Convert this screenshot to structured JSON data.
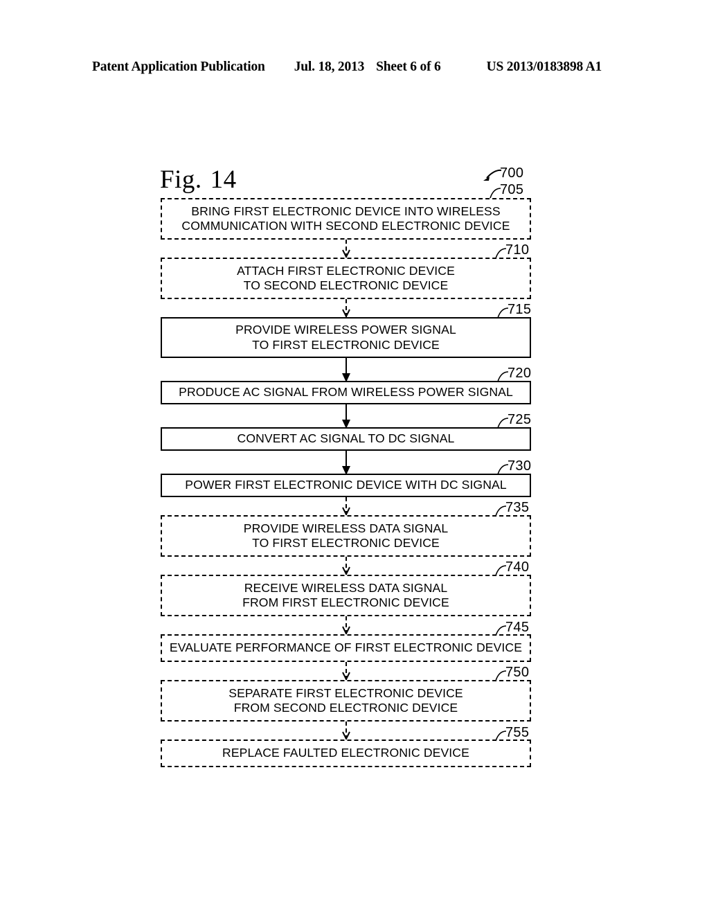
{
  "header": {
    "publication": "Patent Application Publication",
    "date": "Jul. 18, 2013",
    "sheet": "Sheet 6 of 6",
    "publication_number": "US 2013/0183898 A1"
  },
  "figure": {
    "label": "Fig.",
    "number": "14",
    "diagram_ref": "700",
    "steps": [
      {
        "ref": "705",
        "text": "BRING FIRST ELECTRONIC DEVICE INTO WIRELESS\nCOMMUNICATION WITH SECOND ELECTRONIC DEVICE",
        "style": "dashed",
        "lines": 2
      },
      {
        "ref": "710",
        "text": "ATTACH FIRST ELECTRONIC DEVICE\nTO SECOND ELECTRONIC DEVICE",
        "style": "dashed",
        "lines": 2
      },
      {
        "ref": "715",
        "text": "PROVIDE WIRELESS POWER SIGNAL\nTO FIRST ELECTRONIC DEVICE",
        "style": "solid",
        "lines": 2
      },
      {
        "ref": "720",
        "text": "PRODUCE AC SIGNAL FROM WIRELESS POWER SIGNAL",
        "style": "solid",
        "lines": 1
      },
      {
        "ref": "725",
        "text": "CONVERT AC SIGNAL TO DC SIGNAL",
        "style": "solid",
        "lines": 1
      },
      {
        "ref": "730",
        "text": "POWER FIRST ELECTRONIC DEVICE WITH DC SIGNAL",
        "style": "solid",
        "lines": 1
      },
      {
        "ref": "735",
        "text": "PROVIDE WIRELESS DATA SIGNAL\nTO FIRST ELECTRONIC DEVICE",
        "style": "dashed",
        "lines": 2
      },
      {
        "ref": "740",
        "text": "RECEIVE WIRELESS DATA SIGNAL\nFROM FIRST ELECTRONIC DEVICE",
        "style": "dashed",
        "lines": 2
      },
      {
        "ref": "745",
        "text": "EVALUATE PERFORMANCE OF FIRST ELECTRONIC DEVICE",
        "style": "dashed",
        "lines": 1
      },
      {
        "ref": "750",
        "text": "SEPARATE FIRST ELECTRONIC DEVICE\nFROM SECOND ELECTRONIC DEVICE",
        "style": "dashed",
        "lines": 2
      },
      {
        "ref": "755",
        "text": "REPLACE FAULTED ELECTRONIC DEVICE",
        "style": "dashed",
        "lines": 1
      }
    ],
    "connectors": [
      {
        "from": "705",
        "to": "710",
        "style": "dashed",
        "head": "open"
      },
      {
        "from": "710",
        "to": "715",
        "style": "dashed",
        "head": "open"
      },
      {
        "from": "715",
        "to": "720",
        "style": "solid",
        "head": "filled"
      },
      {
        "from": "720",
        "to": "725",
        "style": "solid",
        "head": "filled"
      },
      {
        "from": "725",
        "to": "730",
        "style": "solid",
        "head": "filled"
      },
      {
        "from": "730",
        "to": "735",
        "style": "dashed",
        "head": "open"
      },
      {
        "from": "735",
        "to": "740",
        "style": "dashed",
        "head": "open"
      },
      {
        "from": "740",
        "to": "745",
        "style": "dashed",
        "head": "open"
      },
      {
        "from": "745",
        "to": "750",
        "style": "dashed",
        "head": "open"
      },
      {
        "from": "750",
        "to": "755",
        "style": "dashed",
        "head": "open"
      }
    ]
  },
  "colors": {
    "ink": "#000000",
    "paper": "#ffffff"
  }
}
